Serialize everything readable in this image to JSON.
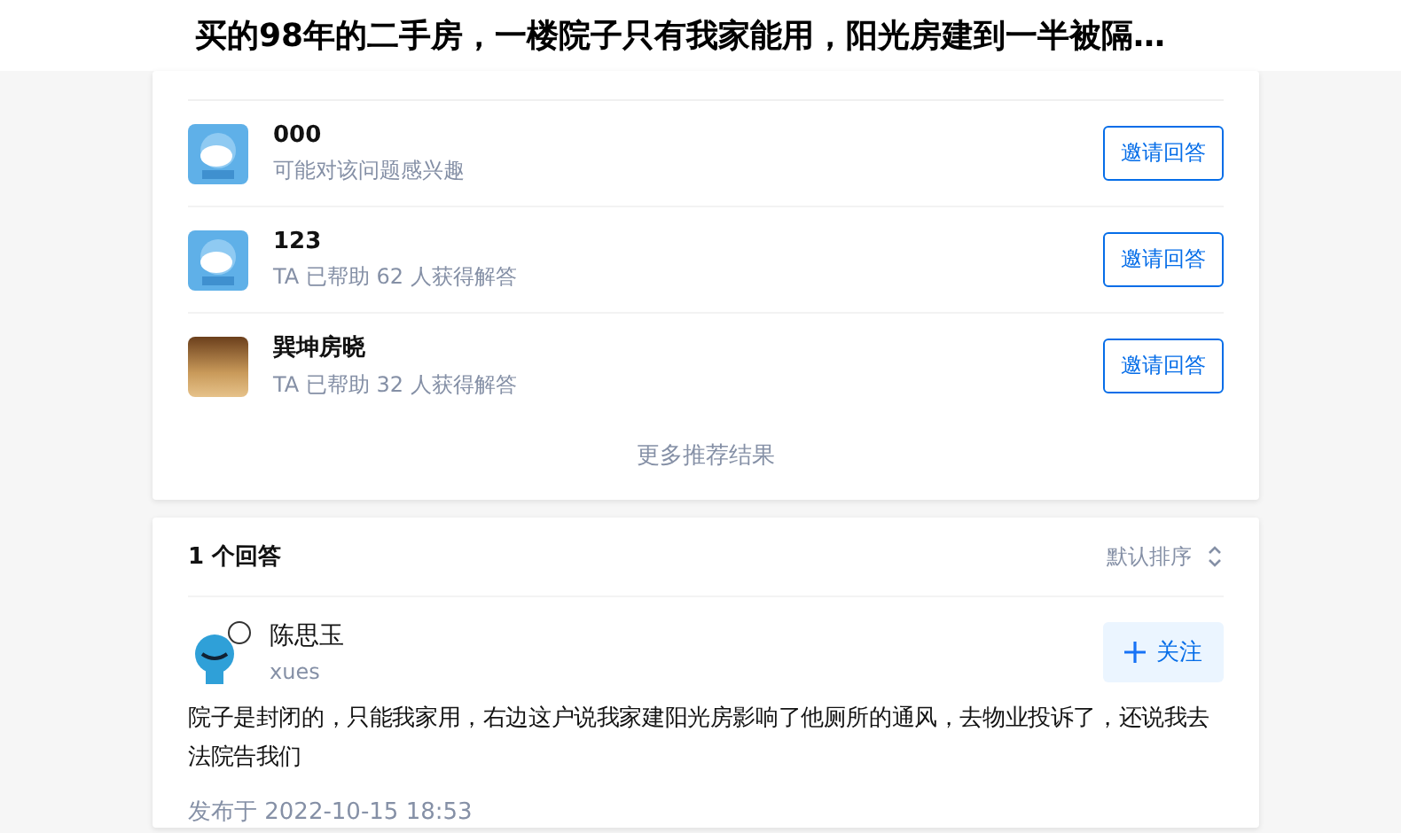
{
  "title": "买的98年的二手房，一楼院子只有我家能用，阳光房建到一半被隔…",
  "recommend": {
    "users": [
      {
        "name": "000",
        "subtitle": "可能对该问题感兴趣",
        "kind": "mascot",
        "button": "邀请回答"
      },
      {
        "name": "123",
        "subtitle": "TA 已帮助 62 人获得解答",
        "kind": "mascot",
        "button": "邀请回答"
      },
      {
        "name": "巽坤房晓",
        "subtitle": "TA 已帮助 32 人获得解答",
        "kind": "photo",
        "button": "邀请回答"
      }
    ],
    "more": "更多推荐结果"
  },
  "answers": {
    "count": "1 个回答",
    "sort": "默认排序",
    "items": [
      {
        "author": "陈思玉",
        "bio": "xues",
        "follow": "关注",
        "content": "院子是封闭的，只能我家用，右边这户说我家建阳光房影响了他厕所的通风，去物业投诉了，还说我去法院告我们",
        "date": "发布于 2022-10-15 18:53"
      }
    ]
  }
}
